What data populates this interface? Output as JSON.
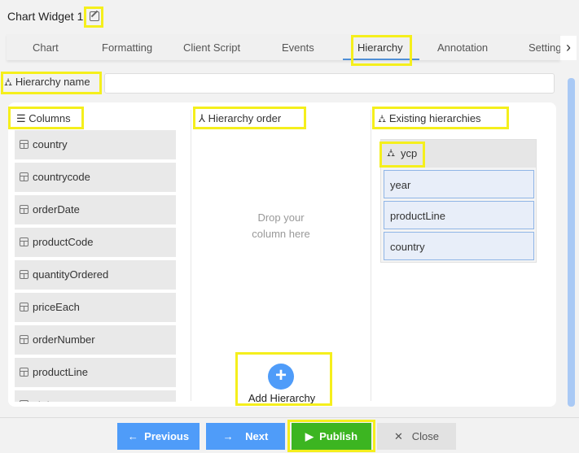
{
  "title": "Chart Widget 1",
  "tabs": [
    "Chart",
    "Formatting",
    "Client Script",
    "Events",
    "Hierarchy",
    "Annotation",
    "Settings"
  ],
  "active_tab": "Hierarchy",
  "hierarchy_name": {
    "label": "Hierarchy name",
    "value": ""
  },
  "columns": {
    "header": "Columns",
    "items": [
      "country",
      "countrycode",
      "orderDate",
      "productCode",
      "quantityOrdered",
      "priceEach",
      "orderNumber",
      "productLine",
      "status"
    ]
  },
  "order": {
    "header": "Hierarchy order",
    "placeholder_line1": "Drop your",
    "placeholder_line2": "column here",
    "add_label": "Add Hierarchy"
  },
  "existing": {
    "header": "Existing hierarchies",
    "hierarchies": [
      {
        "name": "ycp",
        "levels": [
          "year",
          "productLine",
          "country"
        ]
      }
    ]
  },
  "footer": {
    "previous": "Previous",
    "next": "Next",
    "publish": "Publish",
    "close": "Close"
  },
  "colors": {
    "accent": "#4f9cf9",
    "publish": "#3cb521",
    "highlight": "#f5ef1c"
  }
}
